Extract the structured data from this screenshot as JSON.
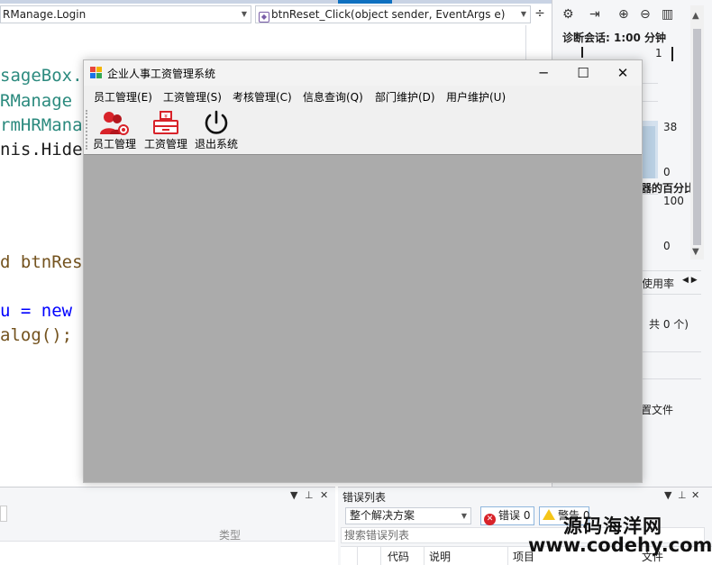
{
  "vs": {
    "class_combo": "RManage.Login",
    "method_combo": "btnReset_Click(object sender, EventArgs e)",
    "code_lines": [
      "sageBox.S",
      "RManage f",
      "rmHRManag",
      "nis.Hide(",
      "d btnRese",
      "u = new",
      "alog();"
    ],
    "diagnostics": {
      "session_label": "诊断会话: 1:00 分钟",
      "num_38": "38",
      "num_0a": "0",
      "percent_label": "器的百分比)",
      "num_100": "100",
      "num_0b": "0",
      "usage_label": "使用率",
      "count_label": "、共 0 个)",
      "file_label": "置文件",
      "tick_1": "1"
    },
    "left_panel": {
      "type_header": "类型"
    },
    "error_list": {
      "title": "错误列表",
      "scope": "整个解决方案",
      "errors_label": "错误 0",
      "warnings_label": "警告 0",
      "search_placeholder": "搜索错误列表",
      "columns": [
        "代码",
        "说明",
        "项目",
        "文件"
      ]
    },
    "watermark": {
      "cn": "源码海洋网",
      "url": "www.codehy.com"
    }
  },
  "app": {
    "title": "企业人事工资管理系统",
    "menu": [
      "员工管理(E)",
      "工资管理(S)",
      "考核管理(C)",
      "信息查询(Q)",
      "部门维护(D)",
      "用户维护(U)"
    ],
    "toolbar": [
      {
        "label": "员工管理",
        "icon": "users-icon"
      },
      {
        "label": "工资管理",
        "icon": "register-icon"
      },
      {
        "label": "退出系统",
        "icon": "power-icon"
      }
    ],
    "colors": {
      "accent_red": "#d8232a",
      "mdi_bg": "#ababab"
    }
  }
}
